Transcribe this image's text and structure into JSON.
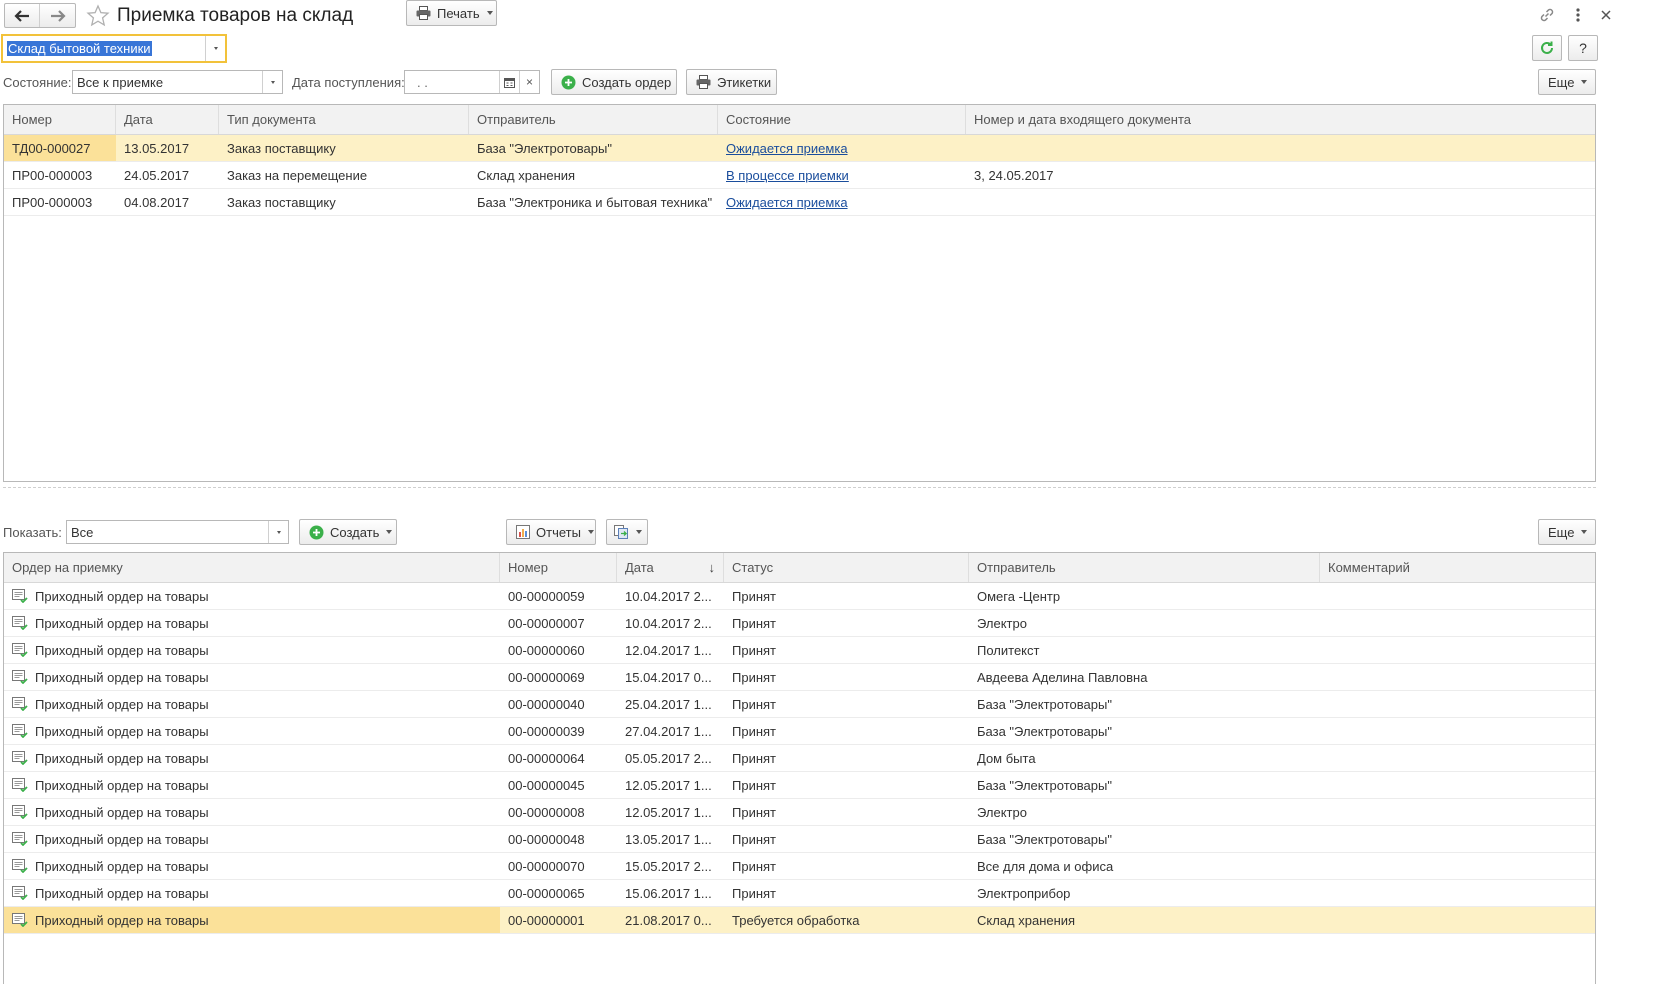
{
  "header": {
    "title": "Приемка товаров на склад",
    "warehouse_value": "Склад бытовой техники",
    "refresh_label": "",
    "help_label": "?"
  },
  "filters": {
    "state_label": "Состояние:",
    "state_value": "Все к приемке",
    "date_label": "Дата поступления:",
    "date_value": ".  .",
    "date_clear": "×",
    "create_order_label": "Создать ордер",
    "labels_label": "Этикетки",
    "more_label": "Еще"
  },
  "top_table": {
    "columns": [
      "Номер",
      "Дата",
      "Тип документа",
      "Отправитель",
      "Состояние",
      "Номер и дата входящего документа"
    ],
    "rows": [
      {
        "number": "ТД00-000027",
        "date": "13.05.2017",
        "type": "Заказ поставщику",
        "sender": "База \"Электротовары\"",
        "state": "Ожидается приемка",
        "incoming": ""
      },
      {
        "number": "ПР00-000003",
        "date": "24.05.2017",
        "type": "Заказ на перемещение",
        "sender": "Склад хранения",
        "state": "В процессе приемки",
        "incoming": "3, 24.05.2017"
      },
      {
        "number": "ПР00-000003",
        "date": "04.08.2017",
        "type": "Заказ поставщику",
        "sender": "База \"Электроника и бытовая техника\"",
        "state": "Ожидается приемка",
        "incoming": ""
      }
    ]
  },
  "bottom_toolbar": {
    "show_label": "Показать:",
    "show_value": "Все",
    "create_label": "Создать",
    "print_label": "Печать",
    "reports_label": "Отчеты",
    "more_label": "Еще"
  },
  "bottom_table": {
    "columns": [
      "Ордер на приемку",
      "Номер",
      "Дата",
      "Статус",
      "Отправитель",
      "Комментарий"
    ],
    "sort_indicator": "↓",
    "rows": [
      {
        "order": "Приходный ордер на товары",
        "number": "00-00000059",
        "date": "10.04.2017 2...",
        "status": "Принят",
        "sender": "Омега -Центр",
        "comment": ""
      },
      {
        "order": "Приходный ордер на товары",
        "number": "00-00000007",
        "date": "10.04.2017 2...",
        "status": "Принят",
        "sender": "Электро",
        "comment": ""
      },
      {
        "order": "Приходный ордер на товары",
        "number": "00-00000060",
        "date": "12.04.2017 1...",
        "status": "Принят",
        "sender": "Политекст",
        "comment": ""
      },
      {
        "order": "Приходный ордер на товары",
        "number": "00-00000069",
        "date": "15.04.2017 0...",
        "status": "Принят",
        "sender": "Авдеева Аделина Павловна",
        "comment": ""
      },
      {
        "order": "Приходный ордер на товары",
        "number": "00-00000040",
        "date": "25.04.2017 1...",
        "status": "Принят",
        "sender": "База \"Электротовары\"",
        "comment": ""
      },
      {
        "order": "Приходный ордер на товары",
        "number": "00-00000039",
        "date": "27.04.2017 1...",
        "status": "Принят",
        "sender": "База \"Электротовары\"",
        "comment": ""
      },
      {
        "order": "Приходный ордер на товары",
        "number": "00-00000064",
        "date": "05.05.2017 2...",
        "status": "Принят",
        "sender": "Дом быта",
        "comment": ""
      },
      {
        "order": "Приходный ордер на товары",
        "number": "00-00000045",
        "date": "12.05.2017 1...",
        "status": "Принят",
        "sender": "База \"Электротовары\"",
        "comment": ""
      },
      {
        "order": "Приходный ордер на товары",
        "number": "00-00000008",
        "date": "12.05.2017 1...",
        "status": "Принят",
        "sender": "Электро",
        "comment": ""
      },
      {
        "order": "Приходный ордер на товары",
        "number": "00-00000048",
        "date": "13.05.2017 1...",
        "status": "Принят",
        "sender": "База \"Электротовары\"",
        "comment": ""
      },
      {
        "order": "Приходный ордер на товары",
        "number": "00-00000070",
        "date": "15.05.2017 2...",
        "status": "Принят",
        "sender": "Все для дома и офиса",
        "comment": ""
      },
      {
        "order": "Приходный ордер на товары",
        "number": "00-00000065",
        "date": "15.06.2017 1...",
        "status": "Принят",
        "sender": "Электроприбор",
        "comment": ""
      },
      {
        "order": "Приходный ордер на товары",
        "number": "00-00000001",
        "date": "21.08.2017 0...",
        "status": "Требуется обработка",
        "sender": "Склад хранения",
        "comment": ""
      }
    ]
  },
  "colors": {
    "selected_row": "#fdf1c6",
    "selected_cell": "#fbe199",
    "link": "#1a4d9c",
    "focus_border": "#f2c23a",
    "create_green": "#3bb04a"
  }
}
